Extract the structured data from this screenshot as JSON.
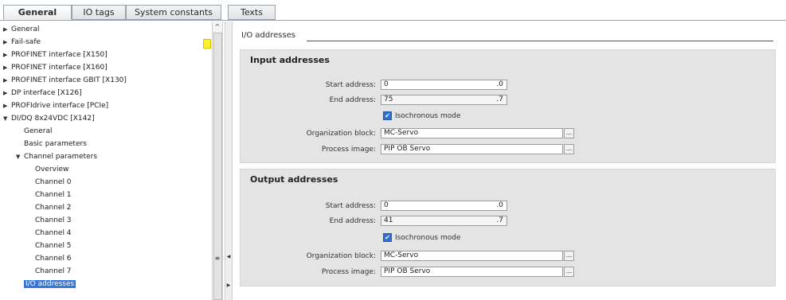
{
  "tabs": [
    {
      "label": "General",
      "active": true
    },
    {
      "label": "IO tags",
      "active": false
    },
    {
      "label": "System constants",
      "active": false
    },
    {
      "label": "Texts",
      "active": false
    }
  ],
  "tree": [
    {
      "label": "General",
      "expander": "▶"
    },
    {
      "label": "Fail-safe",
      "expander": "▶"
    },
    {
      "label": "PROFINET interface [X150]",
      "expander": "▶"
    },
    {
      "label": "PROFINET interface [X160]",
      "expander": "▶"
    },
    {
      "label": "PROFINET interface GBIT [X130]",
      "expander": "▶"
    },
    {
      "label": "DP interface [X126]",
      "expander": "▶"
    },
    {
      "label": "PROFIdrive interface [PCIe]",
      "expander": "▶"
    },
    {
      "label": "DI/DQ 8x24VDC [X142]",
      "expander": "▼"
    },
    {
      "label": "General",
      "expander": ""
    },
    {
      "label": "Basic parameters",
      "expander": ""
    },
    {
      "label": "Channel parameters",
      "expander": "▼"
    },
    {
      "label": "Overview",
      "expander": ""
    },
    {
      "label": "Channel 0",
      "expander": ""
    },
    {
      "label": "Channel 1",
      "expander": ""
    },
    {
      "label": "Channel 2",
      "expander": ""
    },
    {
      "label": "Channel 3",
      "expander": ""
    },
    {
      "label": "Channel 4",
      "expander": ""
    },
    {
      "label": "Channel 5",
      "expander": ""
    },
    {
      "label": "Channel 6",
      "expander": ""
    },
    {
      "label": "Channel 7",
      "expander": ""
    },
    {
      "label": "I/O addresses",
      "expander": "",
      "selected": true
    }
  ],
  "section_title": "I/O addresses",
  "input": {
    "title": "Input addresses",
    "start_label": "Start address:",
    "start_value": "0",
    "start_bit": ".0",
    "end_label": "End address:",
    "end_value": "75",
    "end_bit": ".7",
    "iso_label": "Isochronous mode",
    "ob_label": "Organization block:",
    "ob_value": "MC-Servo",
    "pi_label": "Process image:",
    "pi_value": "PIP OB Servo"
  },
  "output": {
    "title": "Output addresses",
    "start_label": "Start address:",
    "start_value": "0",
    "start_bit": ".0",
    "end_label": "End address:",
    "end_value": "41",
    "end_bit": ".7",
    "iso_label": "Isochronous mode",
    "ob_label": "Organization block:",
    "ob_value": "MC-Servo",
    "pi_label": "Process image:",
    "pi_value": "PIP OB Servo"
  },
  "icons": {
    "browse": "...",
    "check": "✔",
    "scroll_up": "^",
    "grip": "≡",
    "collapse_left": "◀",
    "expand_right": "▶"
  }
}
